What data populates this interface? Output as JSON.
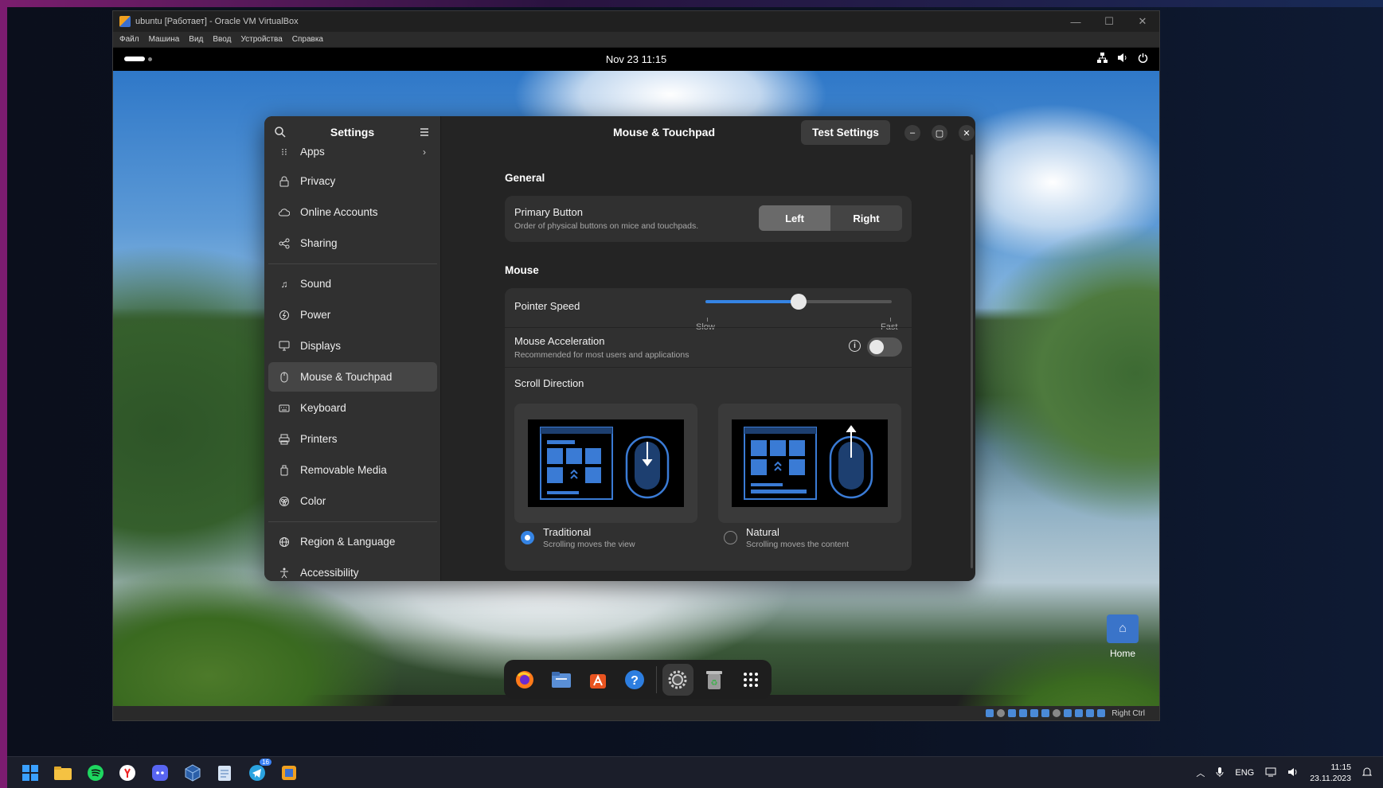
{
  "vbox": {
    "title": "ubuntu [Работает] - Oracle VM VirtualBox",
    "menu": [
      "Файл",
      "Машина",
      "Вид",
      "Ввод",
      "Устройства",
      "Справка"
    ],
    "host_key": "Right Ctrl"
  },
  "gnome": {
    "clock": "Nov 23  11:15"
  },
  "settings": {
    "sidebar_title": "Settings",
    "page_title": "Mouse & Touchpad",
    "test_button": "Test Settings",
    "sidebar_items": [
      {
        "label": "Apps",
        "icon": "apps-grid-icon",
        "chevron": "›"
      },
      {
        "label": "Privacy",
        "icon": "lock-icon"
      },
      {
        "label": "Online Accounts",
        "icon": "cloud-icon"
      },
      {
        "label": "Sharing",
        "icon": "share-icon"
      },
      {
        "label": "Sound",
        "icon": "music-note-icon"
      },
      {
        "label": "Power",
        "icon": "power-icon"
      },
      {
        "label": "Displays",
        "icon": "monitor-icon"
      },
      {
        "label": "Mouse & Touchpad",
        "icon": "mouse-icon",
        "active": true
      },
      {
        "label": "Keyboard",
        "icon": "keyboard-icon"
      },
      {
        "label": "Printers",
        "icon": "printer-icon"
      },
      {
        "label": "Removable Media",
        "icon": "usb-icon"
      },
      {
        "label": "Color",
        "icon": "color-palette-icon"
      },
      {
        "label": "Region & Language",
        "icon": "globe-icon"
      },
      {
        "label": "Accessibility",
        "icon": "accessibility-icon"
      }
    ],
    "general": {
      "heading": "General",
      "primary_button": {
        "title": "Primary Button",
        "subtitle": "Order of physical buttons on mice and touchpads.",
        "left": "Left",
        "right": "Right",
        "selected": "Left"
      }
    },
    "mouse": {
      "heading": "Mouse",
      "pointer_speed": {
        "title": "Pointer Speed",
        "slow": "Slow",
        "fast": "Fast",
        "value": 0.5
      },
      "acceleration": {
        "title": "Mouse Acceleration",
        "subtitle": "Recommended for most users and applications",
        "enabled": false
      },
      "scroll_direction": {
        "title": "Scroll Direction",
        "traditional": {
          "label": "Traditional",
          "desc": "Scrolling moves the view",
          "selected": true
        },
        "natural": {
          "label": "Natural",
          "desc": "Scrolling moves the content",
          "selected": false
        }
      }
    }
  },
  "dock": {
    "items": [
      "firefox-icon",
      "files-icon",
      "app-center-icon",
      "help-icon",
      "settings-icon",
      "trash-icon",
      "show-apps-icon"
    ]
  },
  "desktop": {
    "home_label": "Home"
  },
  "taskbar": {
    "lang": "ENG",
    "time": "11:15",
    "date": "23.11.2023",
    "telegram_badge": "16"
  },
  "colors": {
    "accent": "#3584e4",
    "window_bg": "#242424",
    "sidebar_bg": "#303030"
  }
}
